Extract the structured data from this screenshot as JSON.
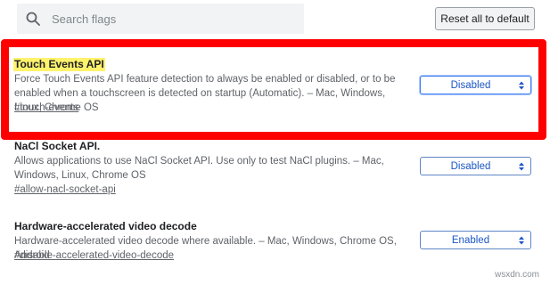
{
  "header": {
    "search_placeholder": "Search flags",
    "reset_button_label": "Reset all to default"
  },
  "flags": [
    {
      "title": "Touch Events API",
      "description": "Force Touch Events API feature detection to always be enabled or disabled, or to be enabled when a touchscreen is detected on startup (Automatic). – Mac, Windows, Linux, Chrome OS",
      "link": "#touch-events",
      "value": "Disabled",
      "highlighted": true
    },
    {
      "title": "NaCl Socket API.",
      "description": "Allows applications to use NaCl Socket API. Use only to test NaCl plugins. – Mac, Windows, Linux, Chrome OS",
      "link": "#allow-nacl-socket-api",
      "value": "Disabled",
      "highlighted": false
    },
    {
      "title": "Hardware-accelerated video decode",
      "description": "Hardware-accelerated video decode where available. – Mac, Windows, Chrome OS, Android",
      "link": "#disable-accelerated-video-decode",
      "value": "Enabled",
      "highlighted": false
    }
  ],
  "watermark": "wsxdn.com",
  "icons": {
    "search": "search-icon",
    "select_arrows": "select-arrows-icon"
  },
  "colors": {
    "highlight_border": "#ff0000",
    "title_highlight": "#fff36b",
    "select_text": "#1a56c4"
  }
}
